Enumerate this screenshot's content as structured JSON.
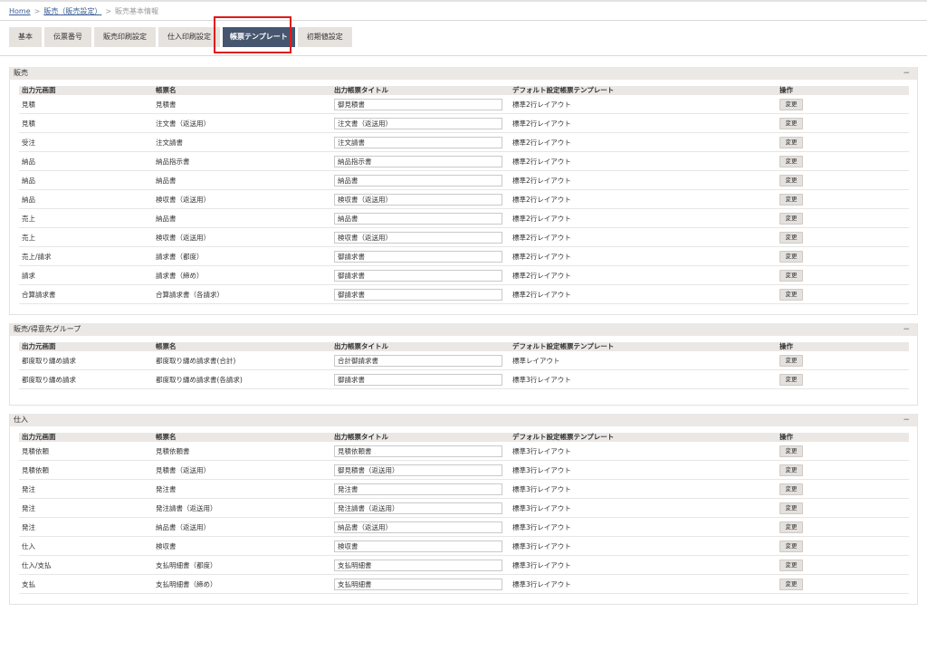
{
  "breadcrumb": {
    "home": "Home",
    "sales_settings": "販売（販売設定）",
    "current": "販売基本情報",
    "separator": ">"
  },
  "tabs": [
    {
      "label": "基本"
    },
    {
      "label": "伝票番号"
    },
    {
      "label": "販売印刷設定"
    },
    {
      "label": "仕入印刷設定"
    },
    {
      "label": "帳票テンプレート",
      "active": true
    },
    {
      "label": "初期値設定"
    }
  ],
  "columns": {
    "source_screen": "出力元画面",
    "form_name": "帳票名",
    "output_title": "出力帳票タイトル",
    "default_template": "デフォルト設定帳票テンプレート",
    "operation": "操作"
  },
  "change_label": "変更",
  "collapse_symbol": "−",
  "sections": [
    {
      "title": "販売",
      "rows": [
        {
          "source": "見積",
          "form": "見積書",
          "title": "御見積書",
          "template": "標準2行レイアウト"
        },
        {
          "source": "見積",
          "form": "注文書（返送用）",
          "title": "注文書（返送用）",
          "template": "標準2行レイアウト"
        },
        {
          "source": "受注",
          "form": "注文請書",
          "title": "注文請書",
          "template": "標準2行レイアウト"
        },
        {
          "source": "納品",
          "form": "納品指示書",
          "title": "納品指示書",
          "template": "標準2行レイアウト"
        },
        {
          "source": "納品",
          "form": "納品書",
          "title": "納品書",
          "template": "標準2行レイアウト"
        },
        {
          "source": "納品",
          "form": "検収書（返送用）",
          "title": "検収書（返送用）",
          "template": "標準2行レイアウト"
        },
        {
          "source": "売上",
          "form": "納品書",
          "title": "納品書",
          "template": "標準2行レイアウト"
        },
        {
          "source": "売上",
          "form": "検収書（返送用）",
          "title": "検収書（返送用）",
          "template": "標準2行レイアウト"
        },
        {
          "source": "売上/請求",
          "form": "請求書（都度）",
          "title": "御請求書",
          "template": "標準2行レイアウト"
        },
        {
          "source": "請求",
          "form": "請求書（締め）",
          "title": "御請求書",
          "template": "標準2行レイアウト"
        },
        {
          "source": "合算請求書",
          "form": "合算請求書（各請求）",
          "title": "御請求書",
          "template": "標準2行レイアウト"
        }
      ]
    },
    {
      "title": "販売/得意先グループ",
      "rows": [
        {
          "source": "都度取り纏め請求",
          "form": "都度取り纏め請求書(合計)",
          "title": "合計御請求書",
          "template": "標準レイアウト"
        },
        {
          "source": "都度取り纏め請求",
          "form": "都度取り纏め請求書(各請求)",
          "title": "御請求書",
          "template": "標準3行レイアウト"
        }
      ]
    },
    {
      "title": "仕入",
      "rows": [
        {
          "source": "見積依頼",
          "form": "見積依頼書",
          "title": "見積依頼書",
          "template": "標準3行レイアウト"
        },
        {
          "source": "見積依頼",
          "form": "見積書（返送用）",
          "title": "御見積書（返送用）",
          "template": "標準3行レイアウト"
        },
        {
          "source": "発注",
          "form": "発注書",
          "title": "発注書",
          "template": "標準3行レイアウト"
        },
        {
          "source": "発注",
          "form": "発注請書（返送用）",
          "title": "発注請書（返送用）",
          "template": "標準3行レイアウト"
        },
        {
          "source": "発注",
          "form": "納品書（返送用）",
          "title": "納品書（返送用）",
          "template": "標準3行レイアウト"
        },
        {
          "source": "仕入",
          "form": "検収書",
          "title": "検収書",
          "template": "標準3行レイアウト"
        },
        {
          "source": "仕入/支払",
          "form": "支払明細書（都度）",
          "title": "支払明細書",
          "template": "標準3行レイアウト"
        },
        {
          "source": "支払",
          "form": "支払明細書（締め）",
          "title": "支払明細書",
          "template": "標準3行レイアウト"
        }
      ]
    }
  ]
}
